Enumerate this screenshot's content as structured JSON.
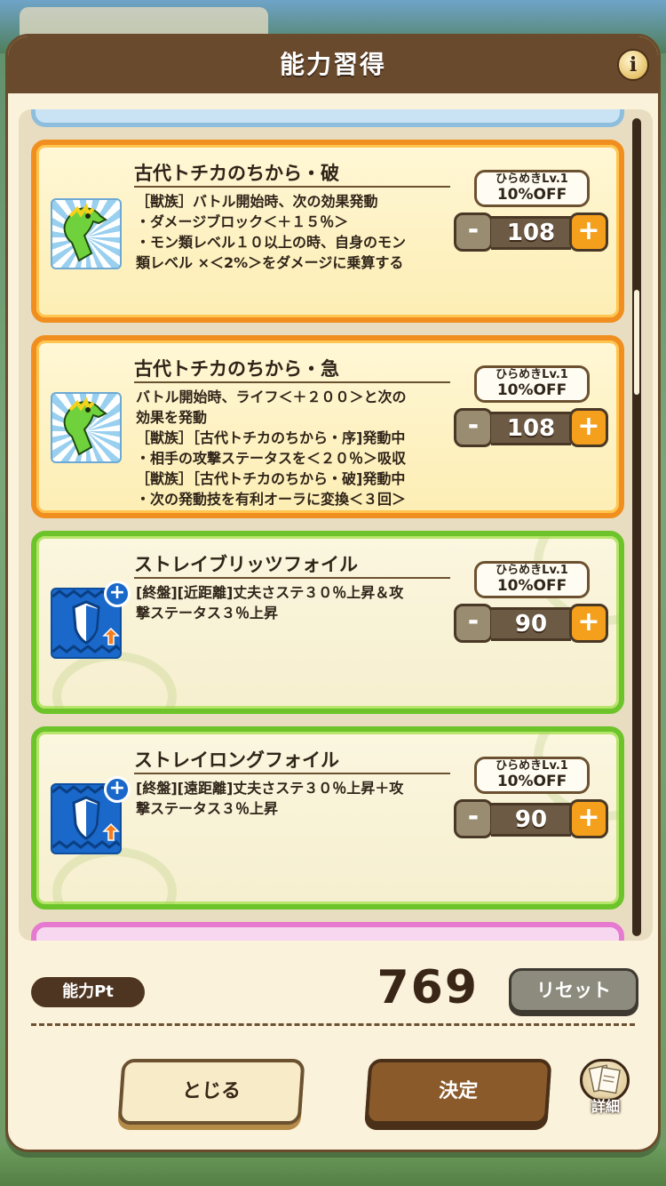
{
  "header": {
    "title": "能力習得",
    "info_label": "i"
  },
  "skills": [
    {
      "title": "古代トチカのちから・破",
      "desc": [
        "［獣族］バトル開始時、次の効果発動",
        "・ダメージブロック＜＋１５％＞",
        "・モン類レベル１０以上の時、自身のモン",
        "類レベル ×＜2%＞をダメージに乗算する"
      ],
      "badge_line1": "ひらめきLv.1",
      "badge_line2": "10%OFF",
      "cost": "108",
      "icon": "dinosaur-icon",
      "frame_color": "#f08f1f"
    },
    {
      "title": "古代トチカのちから・急",
      "desc": [
        "バトル開始時、ライフ＜＋２００＞と次の",
        "効果を発動",
        "［獣族］［古代トチカのちから・序]発動中",
        "・相手の攻撃ステータスを＜２０％＞吸収",
        "［獣族］［古代トチカのちから・破]発動中",
        "・次の発動技を有利オーラに変換＜３回＞"
      ],
      "badge_line1": "ひらめきLv.1",
      "badge_line2": "10%OFF",
      "cost": "108",
      "icon": "dinosaur-icon",
      "frame_color": "#f08f1f"
    },
    {
      "title": "ストレイブリッツフォイル",
      "desc": [
        "[終盤][近距離]丈夫さステ３０％上昇＆攻",
        "撃ステータス３％上昇"
      ],
      "badge_line1": "ひらめきLv.1",
      "badge_line2": "10%OFF",
      "cost": "90",
      "icon": "shield-icon",
      "frame_color": "#6cc42a"
    },
    {
      "title": "ストレイロングフォイル",
      "desc": [
        "[終盤][遠距離]丈夫さステ３０％上昇＋攻",
        "撃ステータス３％上昇"
      ],
      "badge_line1": "ひらめきLv.1",
      "badge_line2": "10%OFF",
      "cost": "90",
      "icon": "shield-icon",
      "frame_color": "#6cc42a"
    }
  ],
  "stepper": {
    "minus": "-",
    "plus": "+"
  },
  "footer": {
    "points_label": "能力Pt",
    "points_value": "769",
    "reset_label": "リセット",
    "close_label": "とじる",
    "confirm_label": "決定",
    "detail_label": "詳細"
  }
}
